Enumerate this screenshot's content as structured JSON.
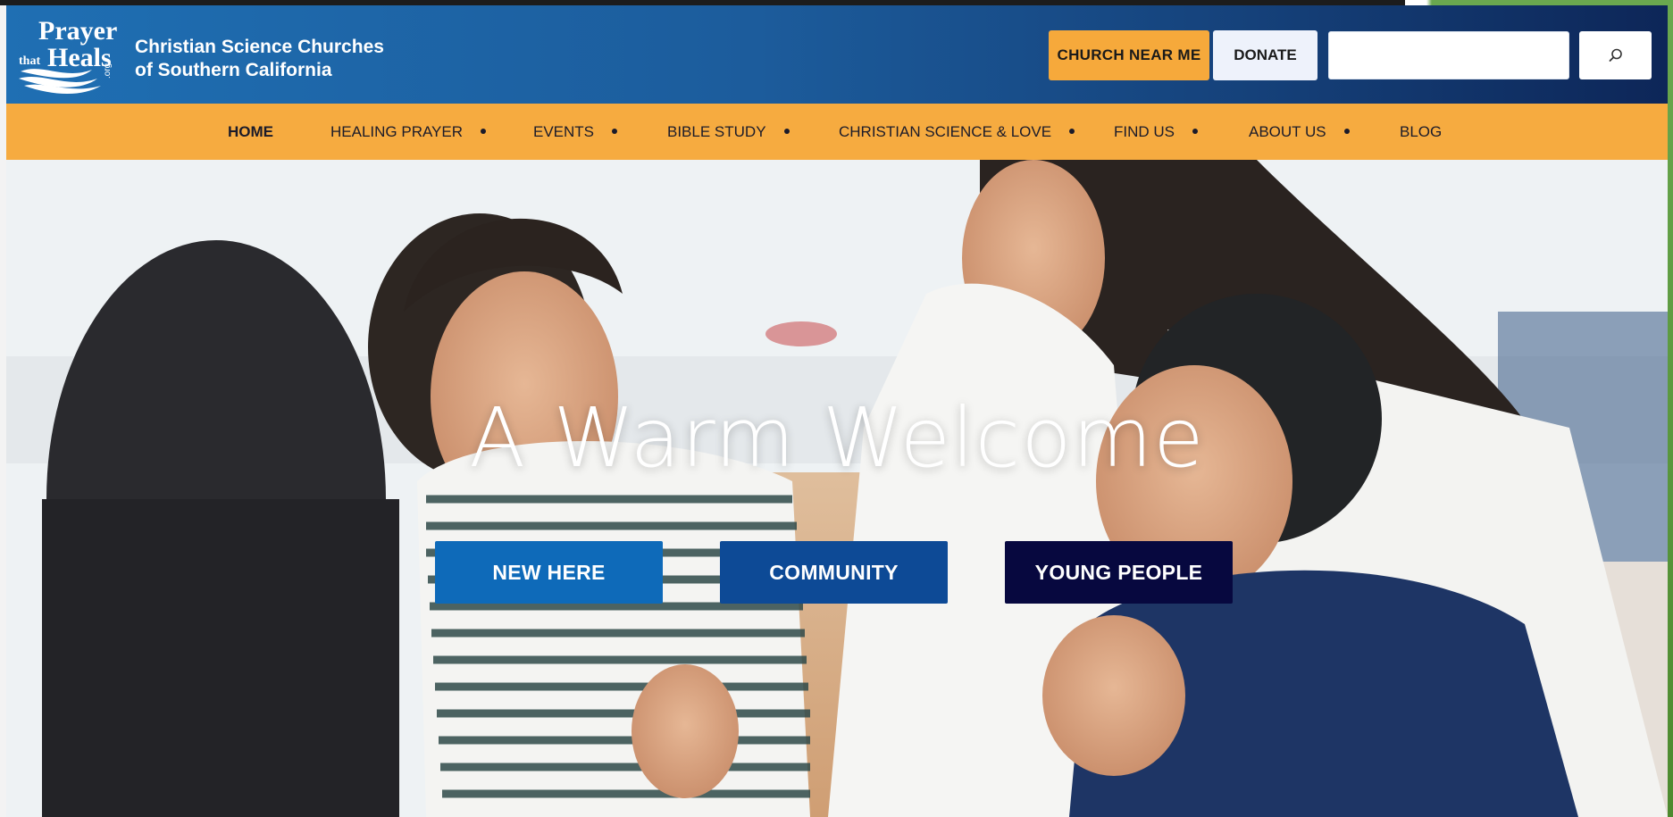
{
  "header": {
    "logo": {
      "line1": "Prayer",
      "line2": "that Heals",
      "line3": ".org"
    },
    "brand_line1": "Christian Science Churches",
    "brand_line2": "of Southern California",
    "church_near_me": "CHURCH NEAR ME",
    "donate": "DONATE",
    "search_value": "",
    "search_icon": "search-icon"
  },
  "nav": {
    "items": [
      {
        "label": "HOME",
        "has_dropdown": false,
        "active": true
      },
      {
        "label": "HEALING PRAYER",
        "has_dropdown": true
      },
      {
        "label": "EVENTS",
        "has_dropdown": true
      },
      {
        "label": "BIBLE STUDY",
        "has_dropdown": true
      },
      {
        "label": "CHRISTIAN SCIENCE & LOVE",
        "has_dropdown": true
      },
      {
        "label": "FIND US",
        "has_dropdown": true
      },
      {
        "label": "ABOUT US",
        "has_dropdown": true
      },
      {
        "label": "BLOG",
        "has_dropdown": false
      }
    ]
  },
  "hero": {
    "title": "A Warm Welcome",
    "buttons": [
      {
        "label": "NEW HERE",
        "color": "#0e6ab9"
      },
      {
        "label": "COMMUNITY",
        "color": "#0d4a96"
      },
      {
        "label": "YOUNG PEOPLE",
        "color": "#07083f"
      }
    ]
  },
  "colors": {
    "header_start": "#1f6fb3",
    "header_end": "#0d2658",
    "nav_bg": "#f6ab40",
    "accent_orange": "#f6a93b"
  }
}
